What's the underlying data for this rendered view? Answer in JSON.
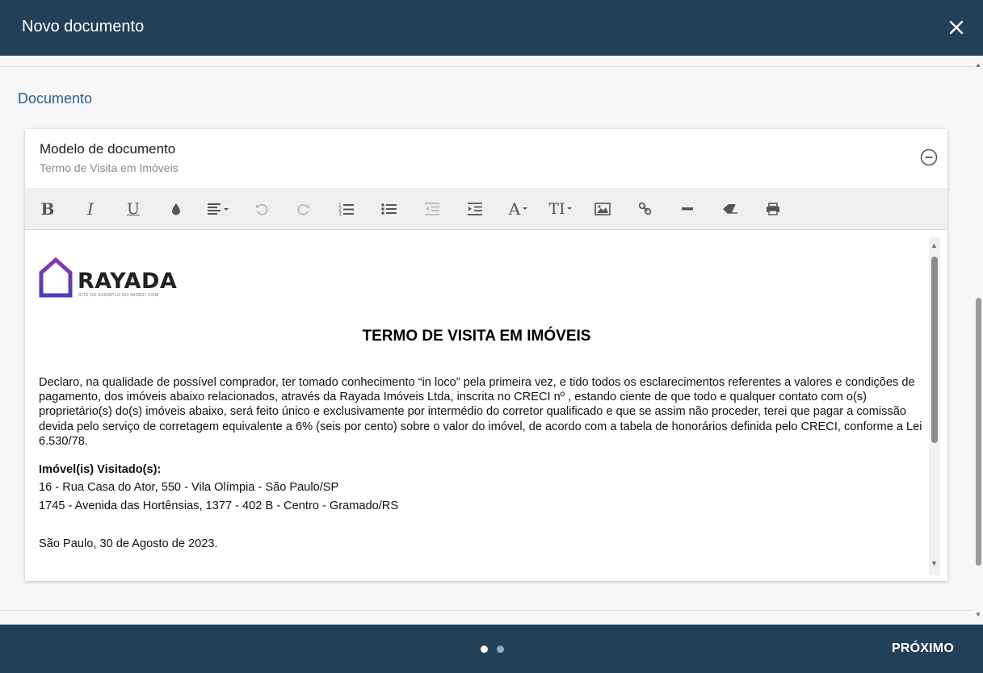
{
  "header": {
    "title": "Novo documento",
    "close_icon": "close-icon"
  },
  "section": {
    "title": "Documento"
  },
  "card": {
    "title": "Modelo de documento",
    "subtitle": "Termo de Visita em Imóveis",
    "collapse_icon": "minus-circle-icon"
  },
  "toolbar": {
    "buttons": [
      "bold",
      "italic",
      "underline",
      "color",
      "align",
      "undo",
      "redo",
      "ordered-list",
      "unordered-list",
      "outdent",
      "indent",
      "font-family",
      "font-size",
      "image",
      "link",
      "horizontal-rule",
      "clear-format",
      "print"
    ],
    "bold_label": "B",
    "italic_label": "I",
    "underline_label": "U",
    "fontfamily_label": "A",
    "fontsize_label": "TI"
  },
  "document": {
    "logo_text": "RAYADA",
    "logo_subtext": "SITE DE EXEMPLO DO IMOBZI.COM",
    "title": "TERMO DE VISITA EM IMÓVEIS",
    "paragraph": "Declaro, na qualidade de possível comprador, ter tomado conhecimento “in loco” pela primeira vez, e tido todos os esclarecimentos referentes a valores e condições de pagamento, dos imóveis abaixo relacionados, através da Rayada Imóveis Ltda, inscrita no CRECI nº , estando ciente de que todo e qualquer contato com o(s) proprietário(s) do(s) imóveis abaixo, será feito único e exclusivamente por intermédio do corretor qualificado e que se assim não proceder, terei que pagar a comissão devida pelo serviço de corretagem equivalente a 6% (seis por cento) sobre o valor do imóvel, de acordo com a tabela de honorários definida pelo CRECI, conforme a Lei 6.530/78.",
    "properties_label": "Imóvel(is) Visitado(s):",
    "properties": [
      "16 - Rua Casa do Ator, 550 - Vila Olímpia - São Paulo/SP",
      "1745 - Avenida das Hortênsias, 1377 - 402 B - Centro - Gramado/RS"
    ],
    "date_line": "São Paulo, 30 de Agosto de 2023."
  },
  "footer": {
    "next_label": "PRÓXIMO",
    "steps_total": 2,
    "step_active": 1
  },
  "colors": {
    "header_bg": "#243f58",
    "section_title": "#2a5e8c",
    "logo_gradient_start": "#8e3aa8",
    "logo_gradient_end": "#4a3fb8"
  }
}
